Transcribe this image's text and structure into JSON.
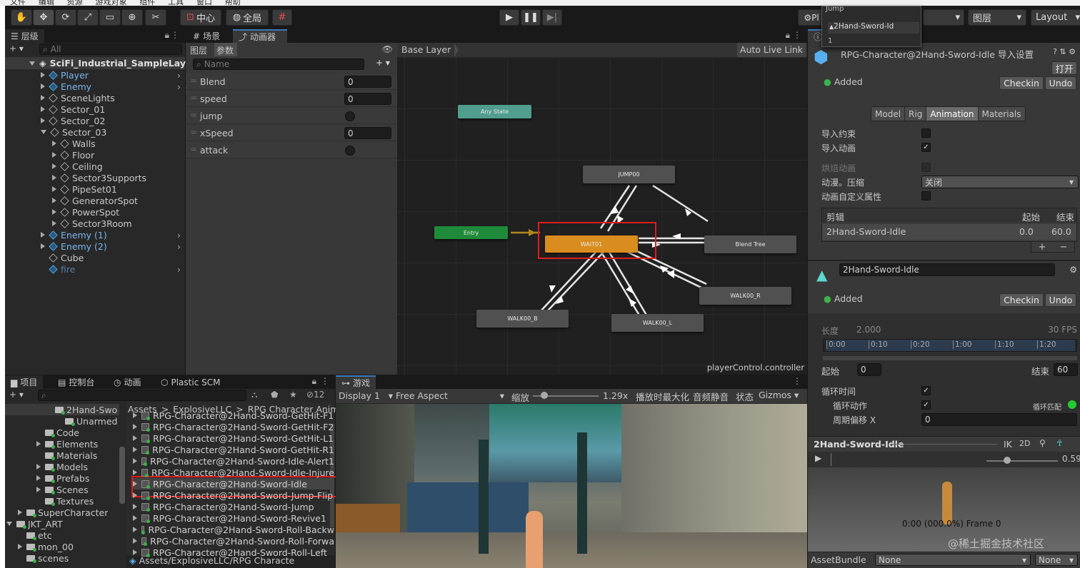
{
  "menubar": {
    "items": [
      "文件",
      "编辑",
      "资源",
      "游戏对象",
      "组件",
      "工具",
      "窗口",
      "帮助"
    ]
  },
  "toolbar": {
    "pivot": "中心",
    "global": "全局",
    "layers": "图层",
    "layout": "Layout",
    "dropdown_tail": "Pl",
    "overlay_jump": "Jump",
    "overlay_item": "2Hand-Sword-Id",
    "overlay_num": "1"
  },
  "hierarchy": {
    "tab": "层级",
    "search": "All",
    "scene": "SciFi_Industrial_SampleLay",
    "items": [
      {
        "label": "Player",
        "blue": true
      },
      {
        "label": "Enemy",
        "blue": true
      },
      {
        "label": "SceneLights"
      },
      {
        "label": "Sector_01"
      },
      {
        "label": "Sector_02"
      },
      {
        "label": "Sector_03"
      },
      {
        "label": "Walls"
      },
      {
        "label": "Floor"
      },
      {
        "label": "Ceiling"
      },
      {
        "label": "Sector3Supports"
      },
      {
        "label": "PipeSet01"
      },
      {
        "label": "GeneratorSpot"
      },
      {
        "label": "PowerSpot"
      },
      {
        "label": "Sector3Room"
      },
      {
        "label": "Enemy (1)",
        "blue": true
      },
      {
        "label": "Enemy (2)",
        "blue": true
      },
      {
        "label": "Cube"
      },
      {
        "label": "fire",
        "blue": true
      }
    ]
  },
  "animator": {
    "tab_scene": "场景",
    "tab_animator": "动画器",
    "sub_layers": "图层",
    "sub_params": "参数",
    "name_placeholder": "Name",
    "breadcrumb": "Base Layer",
    "auto_live": "Auto Live Link",
    "footer": "playerControl.controller",
    "params": [
      {
        "name": "Blend",
        "value": "0"
      },
      {
        "name": "speed",
        "value": "0"
      },
      {
        "name": "jump",
        "value": ""
      },
      {
        "name": "xSpeed",
        "value": "0"
      },
      {
        "name": "attack",
        "value": ""
      }
    ],
    "nodes": {
      "any": "Any State",
      "entry": "Entry",
      "wait": "WAIT01",
      "jump": "JUMP00",
      "blend": "Blend Tree",
      "walkb": "WALK00_B",
      "walkl": "WALK00_L",
      "walkr": "WALK00_R"
    }
  },
  "project": {
    "tabs": [
      "项目",
      "控制台",
      "动画",
      "Plastic SCM"
    ],
    "count": "12",
    "tree": [
      "2Hand-Swo",
      "Unarmed",
      "Code",
      "Elements",
      "Materials",
      "Models",
      "Prefabs",
      "Scenes",
      "Textures",
      "SuperCharacter",
      "JKT_ART",
      "etc",
      "mon_00",
      "scenes"
    ],
    "breadcrumb": [
      "Assets",
      ">",
      "ExplosiveLLC",
      ">",
      "RPG Character Animatio"
    ],
    "files": [
      "RPG-Character@2Hand-Sword-GetHit-F1",
      "RPG-Character@2Hand-Sword-GetHit-F2",
      "RPG-Character@2Hand-Sword-GetHit-L1",
      "RPG-Character@2Hand-Sword-GetHit-R1",
      "RPG-Character@2Hand-Sword-Idle-Alert1",
      "RPG-Character@2Hand-Sword-Idle-Injure",
      "RPG-Character@2Hand-Sword-Idle",
      "RPG-Character@2Hand-Sword-Jump-Flip",
      "RPG-Character@2Hand-Sword-Jump",
      "RPG-Character@2Hand-Sword-Revive1",
      "RPG-Character@2Hand-Sword-Roll-Backw",
      "RPG-Character@2Hand-Sword-Roll-Forwa",
      "RPG-Character@2Hand-Sword-Roll-Left"
    ],
    "path": "Assets/ExplosiveLLC/RPG Characte"
  },
  "game": {
    "tab": "游戏",
    "display": "Display 1",
    "aspect": "Free Aspect",
    "scale_label": "缩放",
    "scale": "1.29x",
    "maximize": "播放时最大化",
    "mute": "音频静音",
    "stats": "状态",
    "gizmos": "Gizmos"
  },
  "inspector": {
    "title": "RPG-Character@2Hand-Sword-Idle 导入设置",
    "open": "打开",
    "added": "Added",
    "checkin": "Checkin",
    "undo": "Undo",
    "tabs": [
      "Model",
      "Rig",
      "Animation",
      "Materials"
    ],
    "import_constraints": "导入约束",
    "import_animation": "导入动画",
    "bake_animation": "烘焙动画",
    "compression_label": "动漫。压缩",
    "compression_value": "关闭",
    "custom_props": "动画自定义属性",
    "clips_header": "剪辑",
    "start_header": "起始",
    "end_header": "结束",
    "clip_name": "2Hand-Sword-Idle",
    "clip_start": "0.0",
    "clip_end": "60.0",
    "clip_field": "2Hand-Sword-Idle",
    "length_label": "长度",
    "length": "2.000",
    "fps": "30 FPS",
    "timeline": [
      "0:00",
      "0:10",
      "0:20",
      "1:00",
      "1:10",
      "1:20"
    ],
    "start_label": "起始",
    "start_val": "0",
    "end_label": "结束",
    "end_val": "60",
    "loop_time": "循环时间",
    "loop_pose": "循环动作",
    "loop_match": "循环匹配",
    "cycle_offset": "周期偏移 X",
    "cycle_val": "0",
    "preview_name": "2Hand-Sword-Idle",
    "ik": "IK",
    "twod": "2D",
    "speed": "0.59",
    "frame": "0:00 (000.0%) Frame 0",
    "assetbundle": "AssetBundle",
    "none1": "None",
    "none2": "None",
    "watermark": "@稀土掘金技术社区"
  }
}
